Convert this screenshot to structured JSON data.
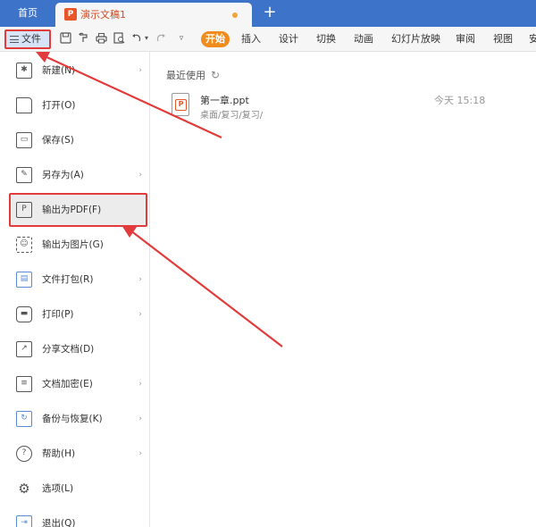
{
  "tabs": {
    "home": "首页",
    "doc_title": "演示文稿1",
    "doc_icon": "P",
    "add": "+"
  },
  "toolbar": {
    "file_label": "文件",
    "icons": [
      "save-icon",
      "format-painter-icon",
      "print-icon",
      "print-preview-icon",
      "undo-icon",
      "redo-icon",
      "more-icon"
    ],
    "start_label": "开始",
    "menus": [
      "插入",
      "设计",
      "切换",
      "动画",
      "幻灯片放映",
      "审阅",
      "视图",
      "安"
    ]
  },
  "file_menu": [
    {
      "label": "新建(N)",
      "icon": "new-icon",
      "has_submenu": true
    },
    {
      "label": "打开(O)",
      "icon": "open-folder-icon",
      "has_submenu": false
    },
    {
      "label": "保存(S)",
      "icon": "save-icon",
      "has_submenu": false
    },
    {
      "label": "另存为(A)",
      "icon": "save-as-icon",
      "has_submenu": true
    },
    {
      "label": "输出为PDF(F)",
      "icon": "pdf-icon",
      "has_submenu": false,
      "highlighted": true
    },
    {
      "label": "输出为图片(G)",
      "icon": "export-image-icon",
      "has_submenu": false
    },
    {
      "label": "文件打包(R)",
      "icon": "package-icon",
      "has_submenu": true
    },
    {
      "label": "打印(P)",
      "icon": "print-icon",
      "has_submenu": true
    },
    {
      "label": "分享文档(D)",
      "icon": "share-icon",
      "has_submenu": false
    },
    {
      "label": "文档加密(E)",
      "icon": "encrypt-icon",
      "has_submenu": true
    },
    {
      "label": "备份与恢复(K)",
      "icon": "backup-icon",
      "has_submenu": true
    },
    {
      "label": "帮助(H)",
      "icon": "help-icon",
      "has_submenu": true
    },
    {
      "label": "选项(L)",
      "icon": "gear-icon",
      "has_submenu": false
    },
    {
      "label": "退出(Q)",
      "icon": "exit-icon",
      "has_submenu": false
    }
  ],
  "recent": {
    "heading": "最近使用",
    "files": [
      {
        "name": "第一章.ppt",
        "path": "桌面/复习/复习/",
        "time": "今天 15:18"
      }
    ]
  },
  "colors": {
    "titlebar": "#3d73c8",
    "accent_orange": "#f08c1c",
    "annotation_red": "#e23b3b",
    "doc_tab_text": "#d14a22"
  }
}
